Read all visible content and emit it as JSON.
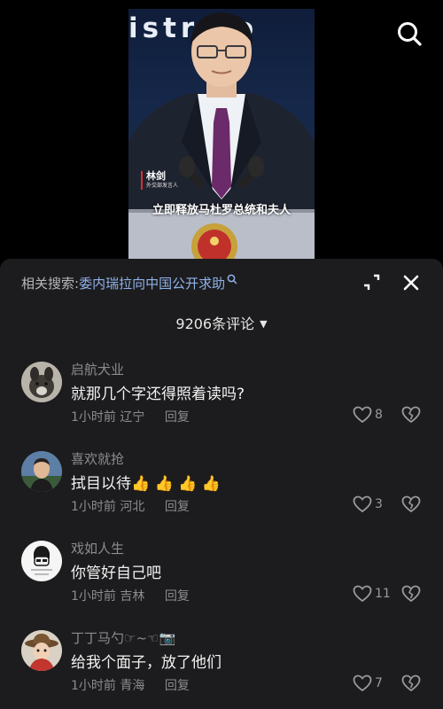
{
  "video": {
    "background_text": "istr  Fo",
    "speaker_name": "林剑",
    "speaker_title": "外交部发言人",
    "subtitle": "立即释放马杜罗总统和夫人"
  },
  "header": {
    "search_icon": "search-icon"
  },
  "comments_panel": {
    "related_label": "相关搜索:",
    "related_query": "委内瑞拉向中国公开求助",
    "collapse_icon": "collapse-corners-icon",
    "close_icon": "close-icon",
    "count_text": "9206条评论",
    "reply_label": "回复",
    "comments": [
      {
        "user": "启航犬业",
        "text": "就那几个字还得照着读吗?",
        "time": "1小时前",
        "location": "辽宁",
        "likes": "8",
        "avatar": "dog-avatar"
      },
      {
        "user": "喜欢就抢",
        "text": "拭目以待👍 👍 👍 👍",
        "time": "1小时前",
        "location": "河北",
        "likes": "3",
        "avatar": "man-avatar"
      },
      {
        "user": "戏如人生",
        "text": "你管好自己吧",
        "time": "1小时前",
        "location": "吉林",
        "likes": "11",
        "avatar": "cartoon-avatar"
      },
      {
        "user": "丁丁马勺☞~☜📷",
        "text": "给我个面子，放了他们",
        "time": "1小时前",
        "location": "青海",
        "likes": "7",
        "avatar": "hat-avatar"
      }
    ]
  },
  "colors": {
    "sheet_bg": "#1c1c1e",
    "link_blue": "#8fb1e8",
    "muted": "#8c8c90"
  }
}
